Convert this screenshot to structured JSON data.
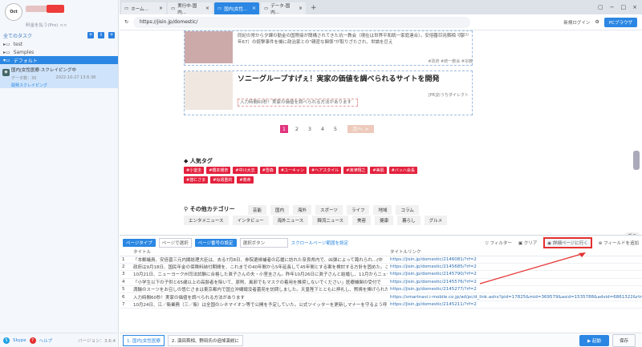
{
  "sidebar": {
    "account_sub": "料金を払う(Pro) <<",
    "tasks_header": "全てのタスク",
    "tree": [
      {
        "label": "test"
      },
      {
        "label": "Samples"
      },
      {
        "label": "デフォルト"
      }
    ],
    "task": {
      "title": "国内|女性医療-スクレイピング中",
      "meta_label": "データ数：",
      "meta_count": "30",
      "date": "2022-10-27 13:6:38",
      "state": "開発スクレイピング"
    },
    "footer": {
      "skype": "Skype",
      "help": "ヘルプ",
      "version": "バージョン：3.6.4"
    }
  },
  "tabs": [
    {
      "label": "ホーム..."
    },
    {
      "label": "実行中-国内..."
    },
    {
      "label": "国内|女性..."
    },
    {
      "label": "データ-国内..."
    }
  ],
  "url": "https://jisin.jp/domestic/",
  "login_label": "新規ログイン",
  "browser_mode": "PCブラウザ",
  "page": {
    "article1": {
      "text": "同紀の常から夕課の勤金の国際接が簡構されてきた坑一教会（現在は世界平和統一家庭連合）。安倍晋三元首相（享年67）の銃撃事件を機に政治家との\"親密な関係\"が取りざたされ、世論を巨え",
      "date": "2022/10/20 06:00",
      "tags": "#政府 #統一教会 #宗教"
    },
    "article2": {
      "title": "ソニーグループすげぇ！実家の価値を調べられるサイトを開発",
      "pr": "[PR]おうちダイレクト",
      "desc": "入力時間60秒！実家の価値を調べられる方法があります"
    },
    "pager": {
      "pages": [
        "1",
        "2",
        "3",
        "4",
        "5"
      ],
      "next": "次へ >"
    },
    "popular_title": "人気タグ",
    "popular": [
      "#小室圭",
      "#橋本環奈",
      "#中川大志",
      "#雪森",
      "#ユーキャン",
      "#ヘアスタイル",
      "#演津翔之",
      "#美肌",
      "#バッハ会長",
      "#悠仁さま",
      "#似週重的",
      "#救命"
    ],
    "category_title": "その他カテゴリー",
    "categories1": [
      "芸能",
      "国内",
      "海外",
      "スポーツ",
      "ライフ",
      "地域",
      "コラム"
    ],
    "categories2": [
      "エンタメニュース",
      "インタビュー",
      "海外ニュース",
      "韓流ニュース",
      "美容",
      "健康",
      "暮らし",
      "グルメ"
    ]
  },
  "panel": {
    "page_type": "ページタイプ",
    "page_select": "ページで選択",
    "page_fmt": "ページ番号の設定",
    "page_btn": "選択ボタン",
    "scroll_link": "スクロールページ範囲を設定",
    "filter": "フィルター",
    "data_clean": "クリア",
    "page_detail": "詳細ページに行く",
    "field_add": "フィールドを追加",
    "collapse": "折る",
    "columns": [
      "",
      "タイトル",
      "タイトルリンク"
    ],
    "rows": [
      {
        "n": "1",
        "title": "「本郵議員、安倍晋三元内閣総理大臣は、去る7月8日、参院選候補者の応援に訪れた奈良県内で、凶弾によって斃れられ...(中",
        "link": "https://jisin.jp/domestic/2146081/?rf=2"
      },
      {
        "n": "2",
        "title": "政府は9月18日、国民年金の保険料納付期間を、これまでの40年間から5年延長して45年間とする案を検討する方針を固めた。これが実現",
        "link": "https://jisin.jp/domestic/2145685/?rf=2"
      },
      {
        "n": "3",
        "title": "10月21日、ニューヨーク州司法試験に合格した眞子さんの夫・小室圭さん。昨年10月26日に眞子さんと結婚し、11月からニューヨークで",
        "link": "https://jisin.jp/domestic/2145790/?rf=2"
      },
      {
        "n": "4",
        "title": "「小学生以下の子供と65歳以上の高齢者を除いて、原則、風邪でもマスクの着用を推奨しないでください」医療機関の受付で",
        "link": "https://jisin.jp/domestic/2145576/?rf=2"
      },
      {
        "n": "5",
        "title": "満輪のスーツをお召しの悠仁さまは東京都内で国立沖縄戦没者墓苑を訪問しました。天皇陛下とともに拝礼し、黙祷を捧げられた",
        "link": "https://jisin.jp/domestic/2145277/?rf=2"
      },
      {
        "n": "6",
        "title": "入力時間60秒！実家の価値を調べられる方法があります",
        "link": "https://smartnavi.i-mobile.co.jp/ad/pc/d_link.ashx?pid=17825&mid=369579&asid=1535788&advid=6861322&rtn=55283d9ee1128c2d66"
      },
      {
        "n": "7",
        "title": "10月24日、江／衛業務（三／衛）は全国のシネマイオン等で公開を予定していた。公式ツイッターを更新しマナーを守るよう呼びかけた",
        "link": "https://jisin.jp/domestic/2145211/?rf=2"
      }
    ]
  },
  "bottom": {
    "tab1": "1. 国内|女性医療",
    "tab2": "2. 演田首相、野田氏の追悼演説に",
    "run": "▶ 起動",
    "save": "保存"
  }
}
